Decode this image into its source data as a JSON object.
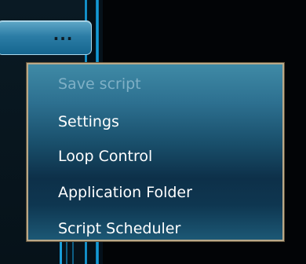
{
  "more_button": {
    "label": "..."
  },
  "context_menu": {
    "items": [
      {
        "label": "Save script",
        "enabled": false
      },
      {
        "label": "Settings",
        "enabled": true
      },
      {
        "label": "Loop Control",
        "enabled": true
      },
      {
        "label": "Application Folder",
        "enabled": true
      },
      {
        "label": "Script Scheduler",
        "enabled": true
      }
    ]
  },
  "colors": {
    "accent_blue": "#19a8e3",
    "menu_border": "#b9a98a",
    "menu_top": "#3f8aa6",
    "menu_bottom": "#0d3049",
    "disabled_text": "#7fb0c6",
    "enabled_text": "#ffffff"
  }
}
